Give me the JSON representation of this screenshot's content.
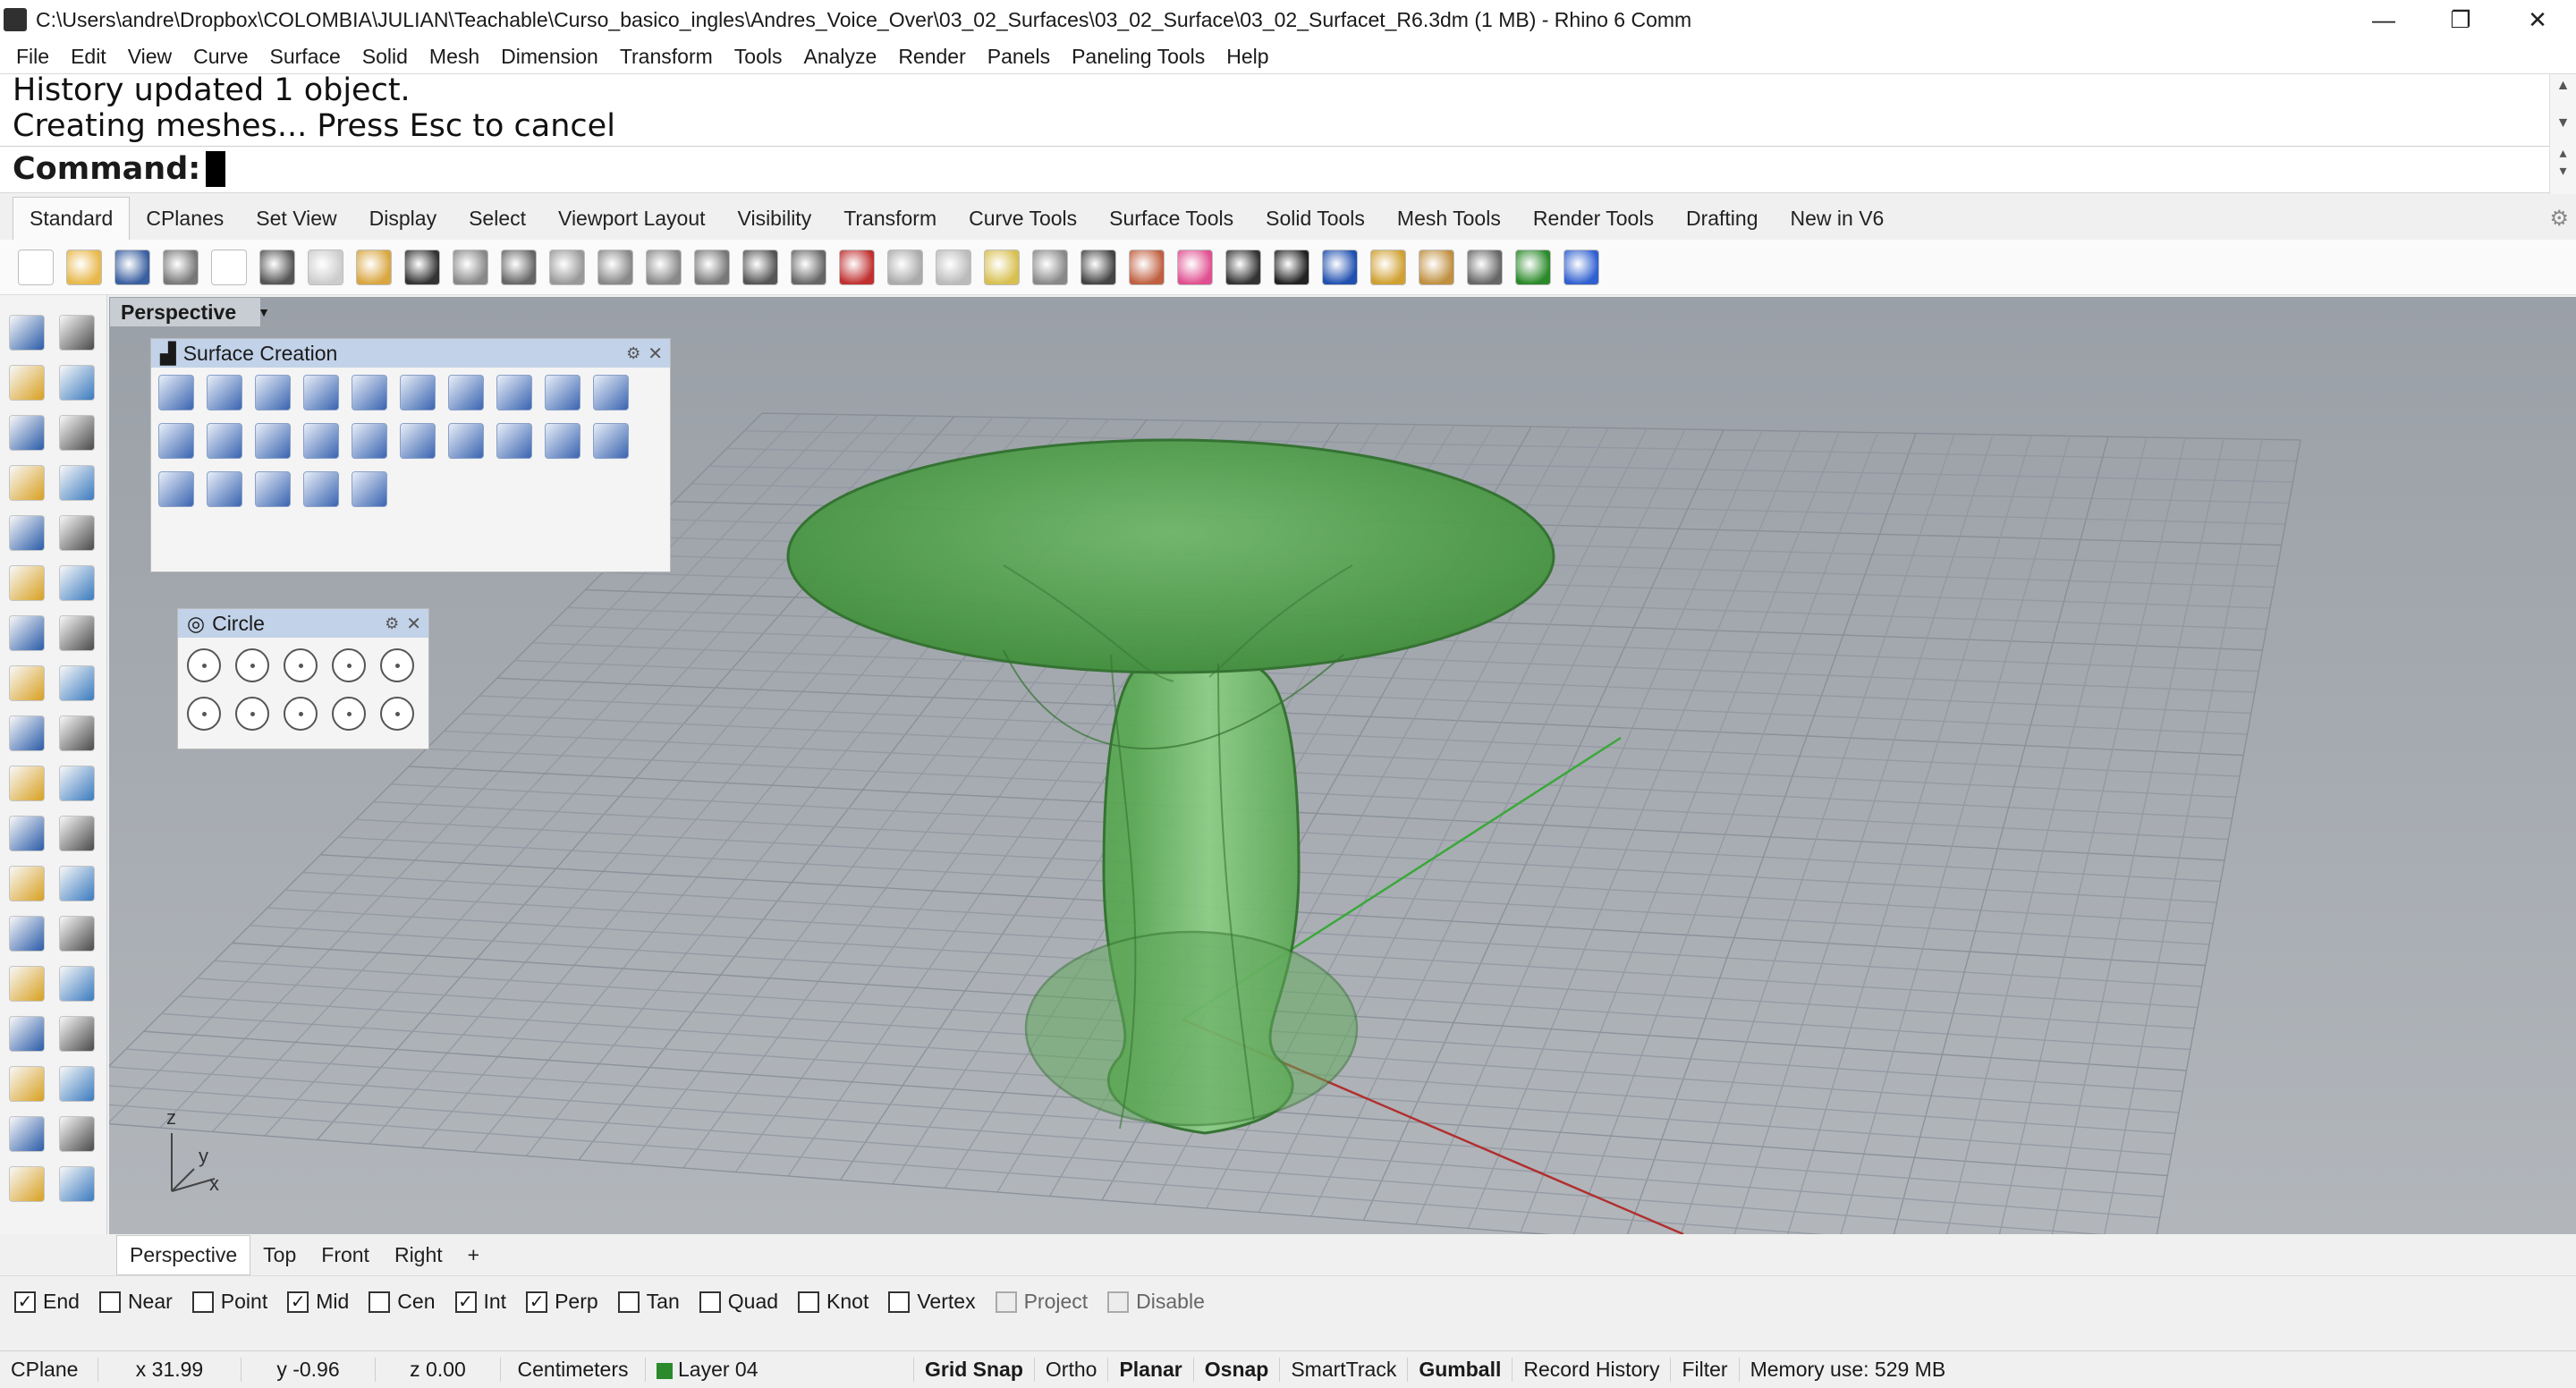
{
  "window": {
    "title": "C:\\Users\\andre\\Dropbox\\COLOMBIA\\JULIAN\\Teachable\\Curso_basico_ingles\\Andres_Voice_Over\\03_02_Surfaces\\03_02_Surface\\03_02_Surfacet_R6.3dm (1 MB) - Rhino 6 Comm",
    "minimize": "—",
    "restore": "❐",
    "close": "✕"
  },
  "menu": [
    "File",
    "Edit",
    "View",
    "Curve",
    "Surface",
    "Solid",
    "Mesh",
    "Dimension",
    "Transform",
    "Tools",
    "Analyze",
    "Render",
    "Panels",
    "Paneling Tools",
    "Help"
  ],
  "command": {
    "history_line1": "History updated 1 object.",
    "history_line2": "Creating meshes... Press Esc to cancel",
    "prompt": "Command:"
  },
  "toolbar_tabs": [
    "Standard",
    "CPlanes",
    "Set View",
    "Display",
    "Select",
    "Viewport Layout",
    "Visibility",
    "Transform",
    "Curve Tools",
    "Surface Tools",
    "Solid Tools",
    "Mesh Tools",
    "Render Tools",
    "Drafting",
    "New in V6"
  ],
  "active_toolbar_tab": "Standard",
  "viewport": {
    "name": "Perspective",
    "axes": {
      "z": "z",
      "y": "y",
      "x": "x"
    }
  },
  "panels": {
    "surface_creation": {
      "title": "Surface Creation"
    },
    "circle": {
      "title": "Circle"
    }
  },
  "viewport_tabs": [
    "Perspective",
    "Top",
    "Front",
    "Right"
  ],
  "viewport_tab_add": "+",
  "osnaps": [
    {
      "label": "End",
      "checked": true
    },
    {
      "label": "Near",
      "checked": false
    },
    {
      "label": "Point",
      "checked": false
    },
    {
      "label": "Mid",
      "checked": true
    },
    {
      "label": "Cen",
      "checked": false
    },
    {
      "label": "Int",
      "checked": true
    },
    {
      "label": "Perp",
      "checked": true
    },
    {
      "label": "Tan",
      "checked": false
    },
    {
      "label": "Quad",
      "checked": false
    },
    {
      "label": "Knot",
      "checked": false
    },
    {
      "label": "Vertex",
      "checked": false
    },
    {
      "label": "Project",
      "checked": false,
      "disabled": true
    },
    {
      "label": "Disable",
      "checked": false,
      "disabled": true
    }
  ],
  "status": {
    "cplane": "CPlane",
    "x": "x 31.99",
    "y": "y -0.96",
    "z": "z 0.00",
    "units": "Centimeters",
    "layer": "Layer 04",
    "layer_color": "#2b8a2b",
    "grid_snap": "Grid Snap",
    "ortho": "Ortho",
    "planar": "Planar",
    "osnap": "Osnap",
    "smarttrack": "SmartTrack",
    "gumball": "Gumball",
    "record_history": "Record History",
    "filter": "Filter",
    "memory": "Memory use: 529 MB"
  },
  "colors": {
    "viewport_bg": "#a3a8ae",
    "surface_green": "#3f9a3a",
    "panel_header": "#c2d2e8",
    "x_axis": "#b03030",
    "y_axis": "#3aa83a"
  }
}
